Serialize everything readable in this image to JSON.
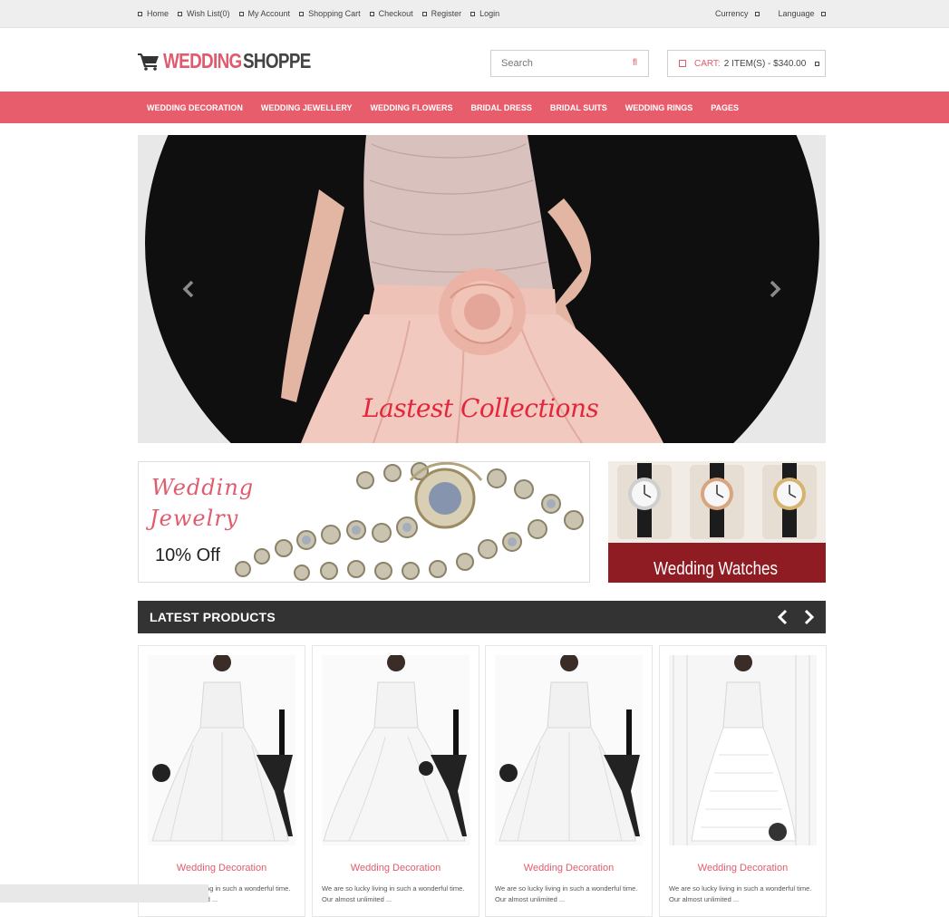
{
  "topbar": {
    "links": [
      {
        "label": "Home"
      },
      {
        "label": "Wish List(0)"
      },
      {
        "label": "My Account"
      },
      {
        "label": "Shopping Cart"
      },
      {
        "label": "Checkout"
      },
      {
        "label": "Register"
      },
      {
        "label": "Login"
      }
    ],
    "currency_label": "Currency",
    "language_label": "Language"
  },
  "header": {
    "logo_part1": "WEDDING",
    "logo_part2": "SHOPPE",
    "search_placeholder": "Search",
    "cart_label": "CART:",
    "cart_total": "2 ITEM(S) - $340.00"
  },
  "nav": {
    "items": [
      {
        "label": "WEDDING DECORATION"
      },
      {
        "label": "WEDDING JEWELLERY"
      },
      {
        "label": "WEDDING FLOWERS"
      },
      {
        "label": "BRIDAL DRESS"
      },
      {
        "label": "BRIDAL SUITS"
      },
      {
        "label": "WEDDING RINGS"
      },
      {
        "label": "PAGES"
      }
    ]
  },
  "slider": {
    "caption": "Lastest Collections"
  },
  "banners": {
    "jewelry_line1": "Wedding",
    "jewelry_line2": "Jewelry",
    "jewelry_offer": "10% Off",
    "watches_title": "Wedding Watches"
  },
  "latest": {
    "title": "LATEST PRODUCTS",
    "products": [
      {
        "name": "Wedding Decoration",
        "desc": "We are so lucky living in such a wonderful time. Our almost unlimited ..."
      },
      {
        "name": "Wedding Decoration",
        "desc": "We are so lucky living in such a wonderful time. Our almost unlimited ..."
      },
      {
        "name": "Wedding Decoration",
        "desc": "We are so lucky living in such a wonderful time. Our almost unlimited ..."
      },
      {
        "name": "Wedding Decoration",
        "desc": "We are so lucky living in such a wonderful time. Our almost unlimited ..."
      }
    ]
  },
  "colors": {
    "accent": "#e85d6c",
    "dark": "#333333"
  },
  "icons": {
    "cart_logo": "shopping-cart-icon",
    "search": "search-icon",
    "cart": "cart-icon",
    "slider_prev": "chevron-left-icon",
    "slider_next": "chevron-right-icon"
  }
}
